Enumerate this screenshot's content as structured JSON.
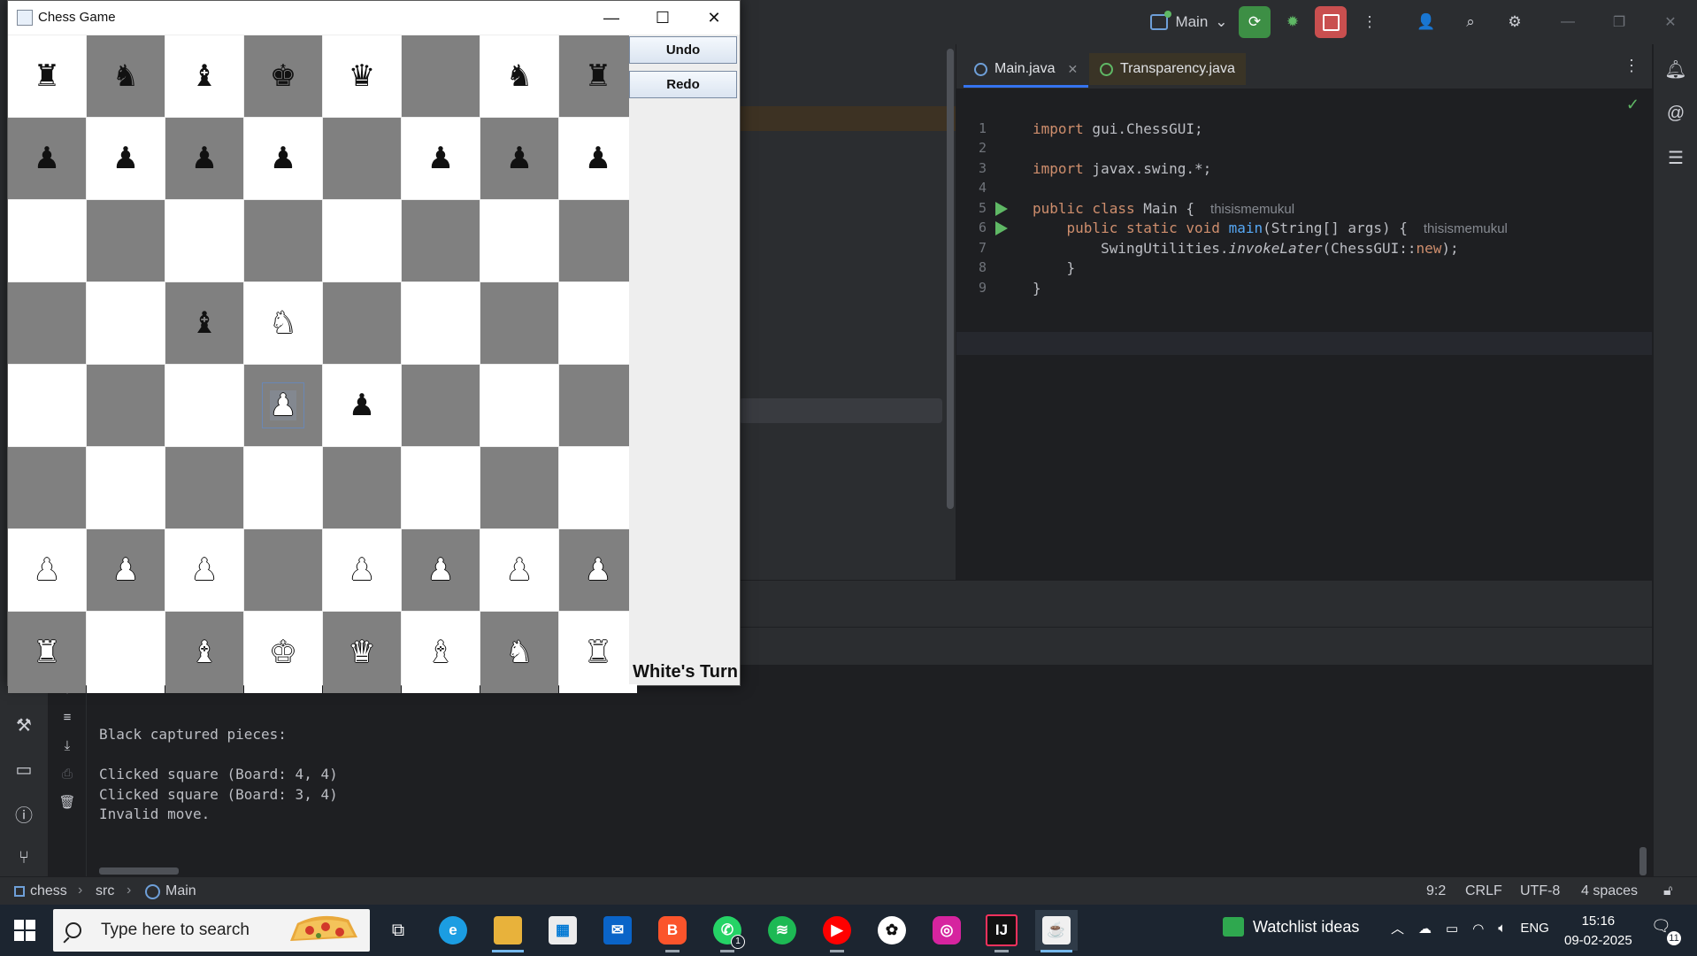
{
  "ide": {
    "run_config": "Main",
    "tabs": [
      {
        "label": "Main.java"
      },
      {
        "label": "Transparency.java"
      }
    ],
    "code": {
      "lines": [
        {
          "num": "1"
        },
        {
          "num": "2"
        },
        {
          "num": "3"
        },
        {
          "num": "4"
        },
        {
          "num": "5"
        },
        {
          "num": "6"
        },
        {
          "num": "7"
        },
        {
          "num": "8"
        },
        {
          "num": "9"
        }
      ],
      "l1_kw": "import",
      "l1_rest": " gui.ChessGUI;",
      "l3_kw": "import",
      "l3_rest": " javax.swing.*;",
      "l5_kw": "public class",
      "l5_rest": " Main {",
      "l5_author": "thisismemukul",
      "l6_kw": "public static void",
      "l6_fn": "main",
      "l6_rest": "(String[] args) {",
      "l6_author": "thisismemukul",
      "l7_a": "SwingUtilities.",
      "l7_it": "invokeLater",
      "l7_b": "(ChessGUI::",
      "l7_kw": "new",
      "l7_c": ");",
      "l8": "}",
      "l9": "}"
    },
    "console": [
      "Black captured pieces:",
      "",
      "Clicked square (Board: 4, 4)",
      "Clicked square (Board: 3, 4)",
      "Invalid move."
    ],
    "statusbar": {
      "crumbs": [
        "chess",
        "src",
        "Main"
      ],
      "position": "9:2",
      "line_sep": "CRLF",
      "encoding": "UTF-8",
      "indent": "4 spaces"
    }
  },
  "chess": {
    "title": "Chess Game",
    "undo_label": "Undo",
    "redo_label": "Redo",
    "turn": "White's Turn",
    "selected_square": [
      4,
      3
    ],
    "board": [
      [
        "bR",
        "bN",
        "bB",
        "bK",
        "bQ",
        "",
        "bN",
        "bR"
      ],
      [
        "bP",
        "bP",
        "bP",
        "bP",
        "",
        "bP",
        "bP",
        "bP"
      ],
      [
        "",
        "",
        "",
        "",
        "",
        "",
        "",
        ""
      ],
      [
        "",
        "",
        "bB",
        "wN",
        "",
        "",
        "",
        ""
      ],
      [
        "",
        "",
        "",
        "wP",
        "bP",
        "",
        "",
        ""
      ],
      [
        "",
        "",
        "",
        "",
        "",
        "",
        "",
        ""
      ],
      [
        "wP",
        "wP",
        "wP",
        "",
        "wP",
        "wP",
        "wP",
        "wP"
      ],
      [
        "wR",
        "",
        "wB",
        "wK",
        "wQ",
        "wB",
        "wN",
        "wR"
      ]
    ]
  },
  "taskbar": {
    "search_placeholder": "Type here to search",
    "watchlist": "Watchlist ideas",
    "lang": "ENG",
    "time": "15:16",
    "date": "09-02-2025",
    "notifications": "11",
    "whatsapp_badge": "1"
  }
}
